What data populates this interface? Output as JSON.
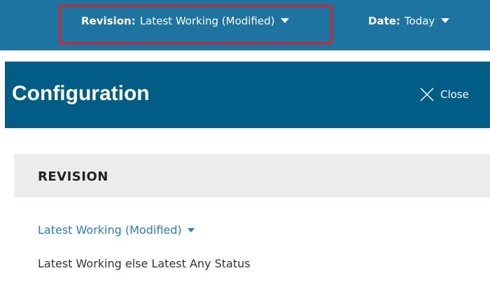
{
  "toolbar": {
    "revision_label": "Revision:",
    "revision_value": "Latest Working (Modified)",
    "date_label": "Date:",
    "date_value": "Today"
  },
  "header": {
    "title": "Configuration",
    "close_label": "Close"
  },
  "revision_section": {
    "title": "REVISION",
    "dropdown_value": "Latest Working (Modified)",
    "description": "Latest Working else Latest Any Status"
  },
  "colors": {
    "topbar": "#1d74a0",
    "header": "#015c86",
    "highlight": "#d9232e",
    "link": "#2a7dbe",
    "section_bar": "#ececec"
  },
  "icons": {
    "close": "close-icon",
    "revision_caret": "chevron-down-icon",
    "date_caret": "chevron-down-icon",
    "dropdown_caret": "chevron-down-icon"
  }
}
